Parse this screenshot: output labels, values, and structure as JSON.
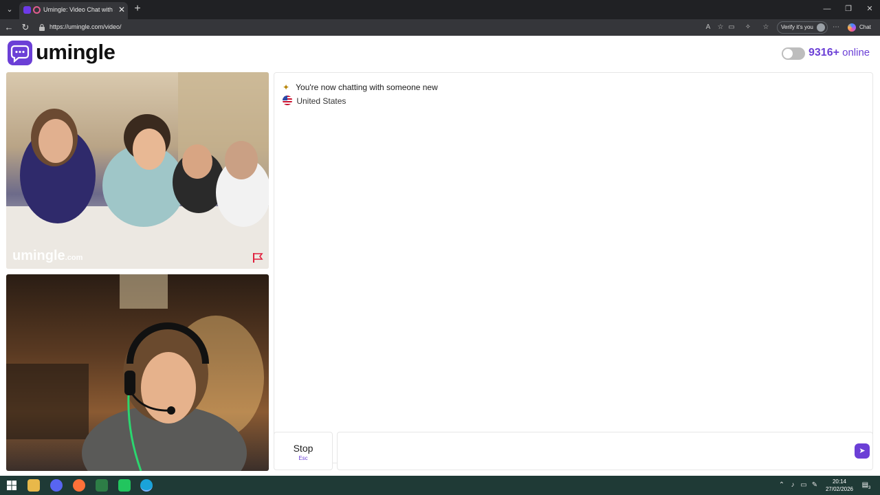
{
  "browser": {
    "tab_title": "Umingle: Video Chat with Str",
    "tab_close": "✕",
    "new_tab": "+",
    "url": "https://umingle.com/video/",
    "verify_label": "Verify it's you",
    "copilot_label": "Chat",
    "window_controls": [
      "—",
      "❐",
      "✕"
    ]
  },
  "site": {
    "brand": "umingle",
    "online_count": "9316+",
    "online_label": "online"
  },
  "video": {
    "watermark_main": "umingle",
    "watermark_tld": ".com"
  },
  "chat": {
    "status_message": "You're now chatting with someone new",
    "country": "United States"
  },
  "controls": {
    "stop_label": "Stop",
    "stop_shortcut": "Esc",
    "message_value": "",
    "send_icon": "➤"
  },
  "taskbar": {
    "time": "20:14",
    "date": "27/02/2026",
    "notification_count": "3"
  },
  "colors": {
    "brand_purple": "#6b3fd6",
    "browser_dark": "#202124",
    "taskbar": "#1f3a36"
  }
}
